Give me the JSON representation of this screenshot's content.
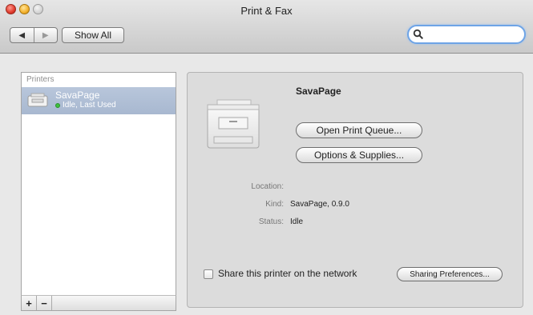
{
  "window": {
    "title": "Print & Fax",
    "show_all_label": "Show All",
    "back_glyph": "◀",
    "forward_glyph": "▶"
  },
  "search": {
    "value": "",
    "placeholder": "",
    "icon": "magnifier-icon"
  },
  "printer_list": {
    "header": "Printers",
    "items": [
      {
        "name": "SavaPage",
        "status": "Idle, Last Used",
        "status_color": "#3ec23e",
        "selected": true
      }
    ],
    "add_label": "+",
    "remove_label": "−"
  },
  "detail": {
    "name": "SavaPage",
    "open_queue_label": "Open Print Queue...",
    "options_label": "Options & Supplies...",
    "location_label": "Location:",
    "location_value": "",
    "kind_label": "Kind:",
    "kind_value": "SavaPage, 0.9.0",
    "status_label": "Status:",
    "status_value": "Idle",
    "share_label": "Share this printer on the network",
    "share_checked": false,
    "sharing_prefs_label": "Sharing Preferences..."
  },
  "colors": {
    "selection": "#aebdd4",
    "search_focus": "#6ea4e6"
  }
}
